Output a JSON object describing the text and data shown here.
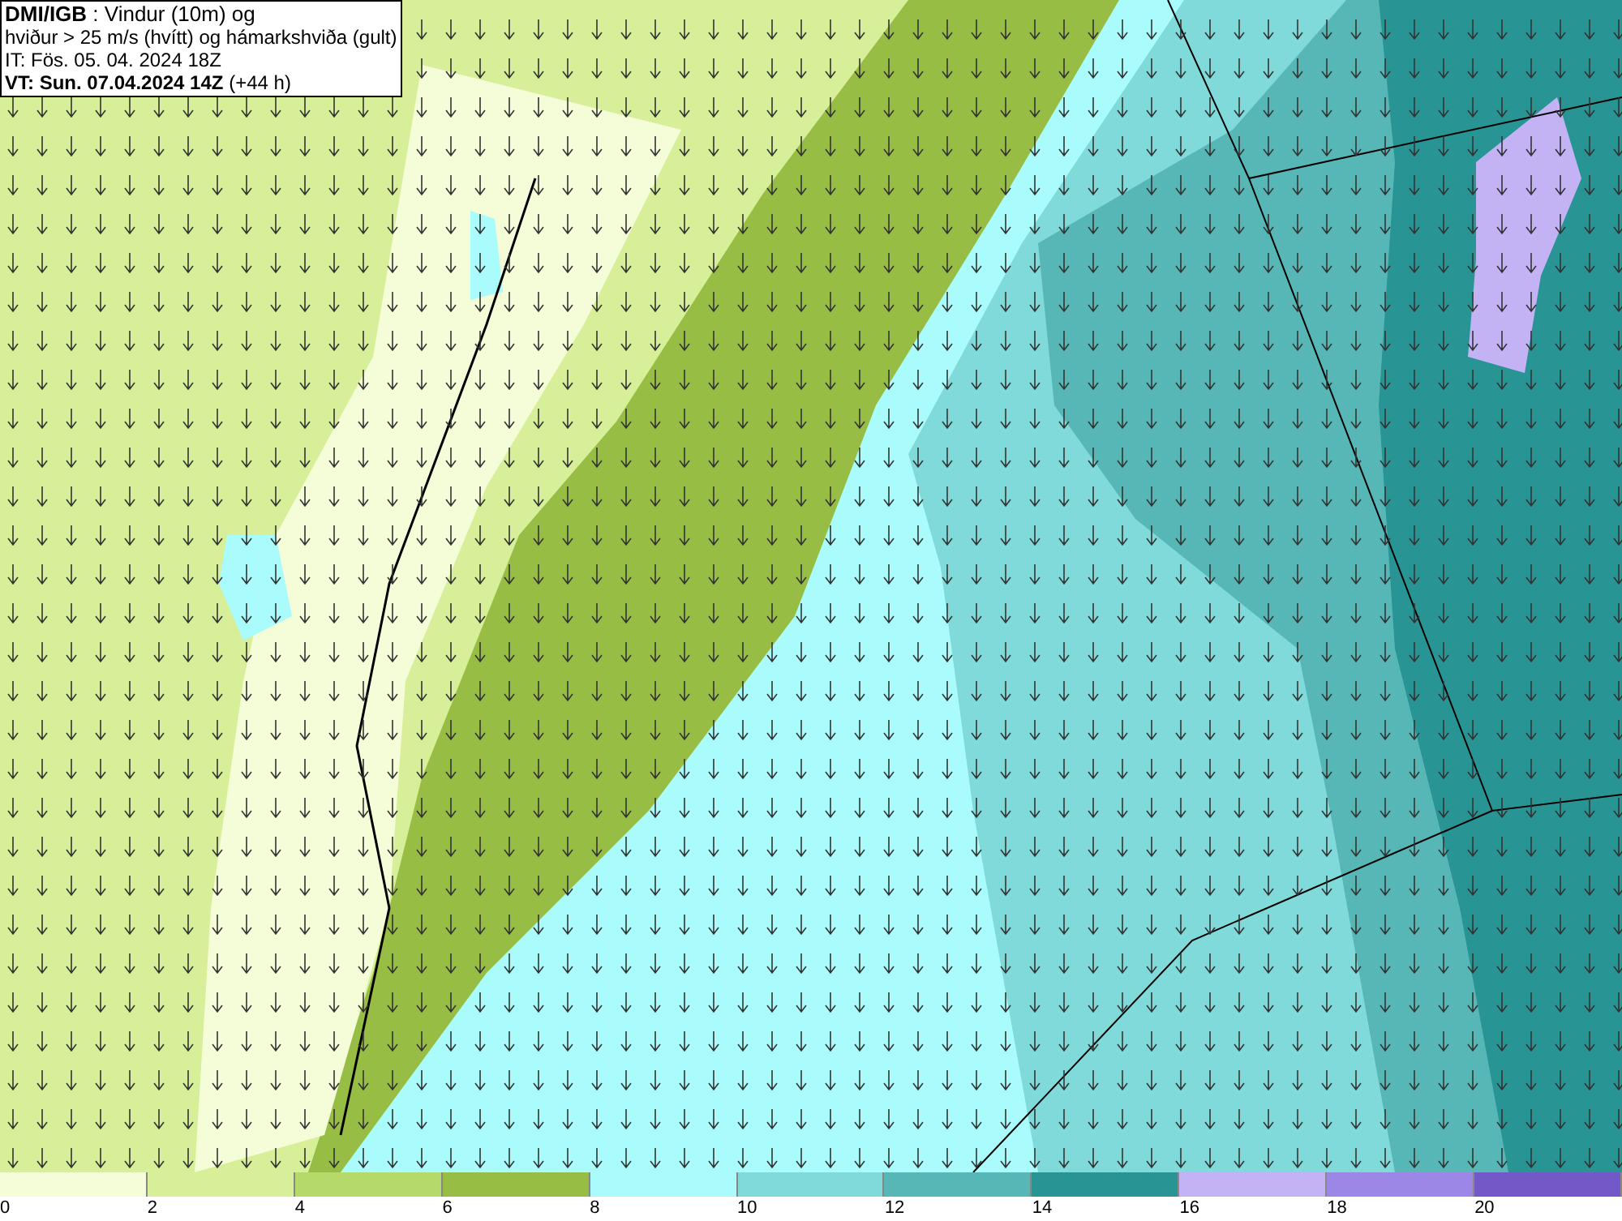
{
  "info_box": {
    "lines": [
      "**DMI/IGB** : Vindur (10m) og",
      "hviður > 25 m/s (hvítt) og hámarkshviða (gult)",
      "IT: Fös. 05. 04. 2024 18Z",
      "**VT: Sun. 07.04.2024 14Z** (+44 h)"
    ]
  },
  "legend": {
    "bins": [
      {
        "label": "0",
        "color": "#f4fcd8"
      },
      {
        "label": "2",
        "color": "#d6ef98"
      },
      {
        "label": "4",
        "color": "#b5da6a"
      },
      {
        "label": "6",
        "color": "#97bd44"
      },
      {
        "label": "8",
        "color": "#aafcfc"
      },
      {
        "label": "10",
        "color": "#80dada"
      },
      {
        "label": "12",
        "color": "#57b7b7"
      },
      {
        "label": "14",
        "color": "#299494"
      },
      {
        "label": "16",
        "color": "#c3b3f5"
      },
      {
        "label": "18",
        "color": "#9c86e6"
      },
      {
        "label": "20",
        "color": "#7358c8"
      }
    ]
  }
}
